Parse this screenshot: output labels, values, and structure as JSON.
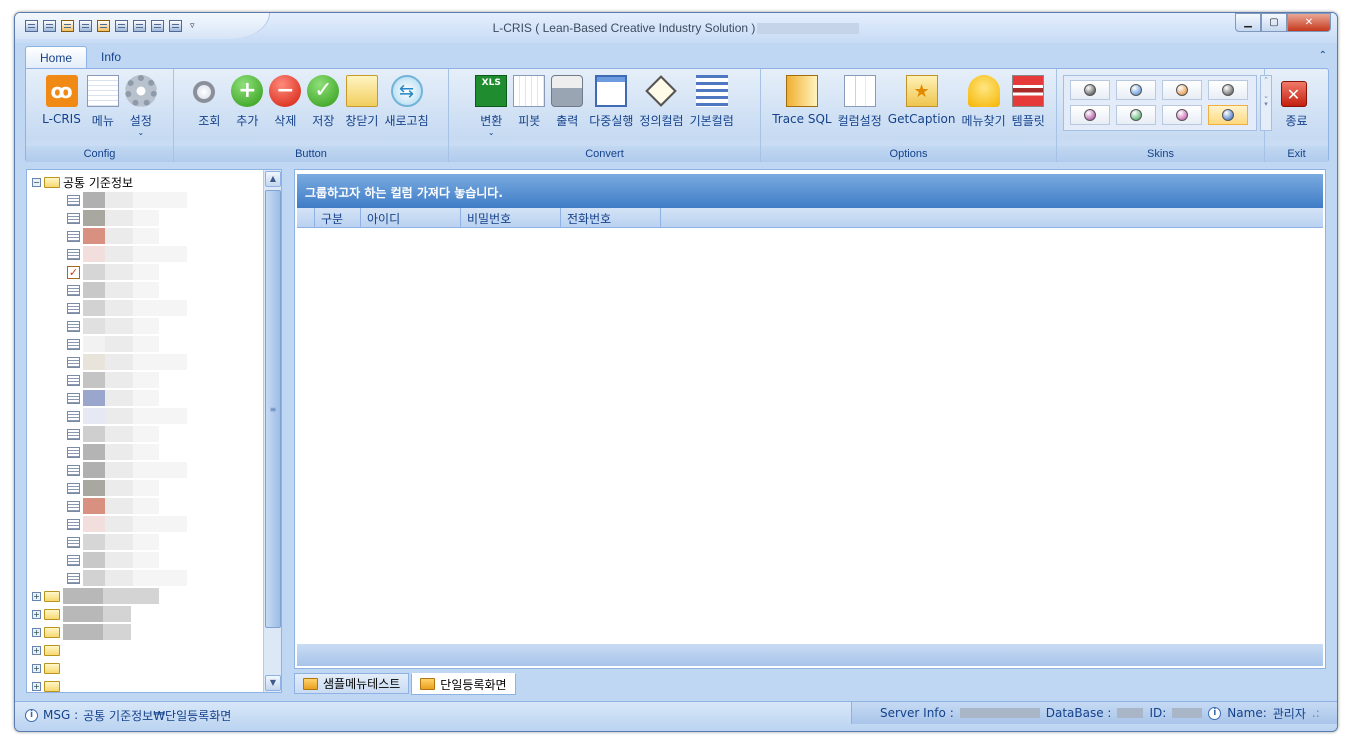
{
  "window": {
    "title": "L-CRIS ( Lean-Based Creative Industry Solution )"
  },
  "tabs": [
    {
      "label": "Home"
    },
    {
      "label": "Info"
    }
  ],
  "ribbon": {
    "groups": {
      "config": "Config",
      "button": "Button",
      "convert": "Convert",
      "options": "Options",
      "skins": "Skins",
      "exit": "Exit"
    },
    "config": [
      {
        "label": "L-CRIS",
        "icon": "lcris-logo-icon"
      },
      {
        "label": "메뉴",
        "icon": "menu-grid-icon"
      },
      {
        "label": "설정",
        "icon": "gear-icon"
      }
    ],
    "button": [
      {
        "label": "조회",
        "icon": "magnifier-icon"
      },
      {
        "label": "추가",
        "icon": "plus-circle-icon"
      },
      {
        "label": "삭제",
        "icon": "minus-circle-icon"
      },
      {
        "label": "저장",
        "icon": "check-circle-icon"
      },
      {
        "label": "창닫기",
        "icon": "folder-icon"
      },
      {
        "label": "새로고침",
        "icon": "refresh-icon"
      }
    ],
    "convert": [
      {
        "label": "변환",
        "icon": "xls-icon",
        "badge": "XLS"
      },
      {
        "label": "피봇",
        "icon": "pivot-chart-icon"
      },
      {
        "label": "출력",
        "icon": "printer-icon"
      },
      {
        "label": "다중실행",
        "icon": "windows-icon"
      },
      {
        "label": "정의컬럼",
        "icon": "diamond-check-icon"
      },
      {
        "label": "기본컬럼",
        "icon": "list-icon"
      }
    ],
    "options": [
      {
        "label": "Trace SQL",
        "icon": "database-icon"
      },
      {
        "label": "컬럼설정",
        "icon": "columns-icon"
      },
      {
        "label": "GetCaption",
        "icon": "star-folder-icon"
      },
      {
        "label": "메뉴찾기",
        "icon": "find-menu-icon"
      },
      {
        "label": "템플릿",
        "icon": "template-icon"
      }
    ],
    "skins": [
      {
        "color": "#333333"
      },
      {
        "color": "#3f7fd0"
      },
      {
        "color": "#e08020"
      },
      {
        "color": "#444444"
      },
      {
        "color": "#a03090"
      },
      {
        "color": "#30a050"
      },
      {
        "color": "#c040a0"
      },
      {
        "color": "#2060c0",
        "selected": true
      }
    ],
    "exit": {
      "label": "종료",
      "icon": "close-x-icon"
    }
  },
  "tree": {
    "root_label": "공통 기준정보"
  },
  "grid": {
    "group_panel_text": "그룹하고자 하는 컬럼 가져다 놓습니다.",
    "columns": [
      "구분",
      "아이디",
      "비밀번호",
      "전화번호"
    ]
  },
  "doc_tabs": [
    {
      "label": "샘플메뉴테스트"
    },
    {
      "label": "단일등록화면",
      "active": true
    }
  ],
  "status": {
    "msg_label": "MSG :",
    "msg_value": "공통 기준정보₩단일등록화면",
    "server_label": "Server Info :",
    "database_label": "DataBase :",
    "id_label": "ID:",
    "name_label": "Name:",
    "name_value": "관리자"
  }
}
